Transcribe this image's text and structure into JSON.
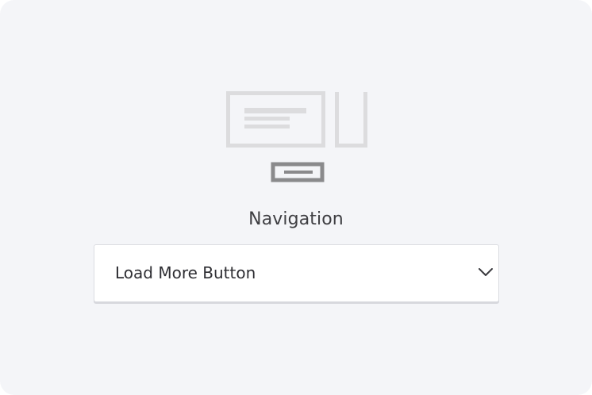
{
  "navigation": {
    "label": "Navigation",
    "illustration_icon": "load-more-layout-icon",
    "select": {
      "value": "Load More Button",
      "icon": "chevron-down-icon"
    }
  },
  "colors": {
    "panel_background": "#f4f5f8",
    "illustration_light": "#dcdcde",
    "illustration_dark": "#8a8a8c",
    "text": "#3e3e42"
  }
}
